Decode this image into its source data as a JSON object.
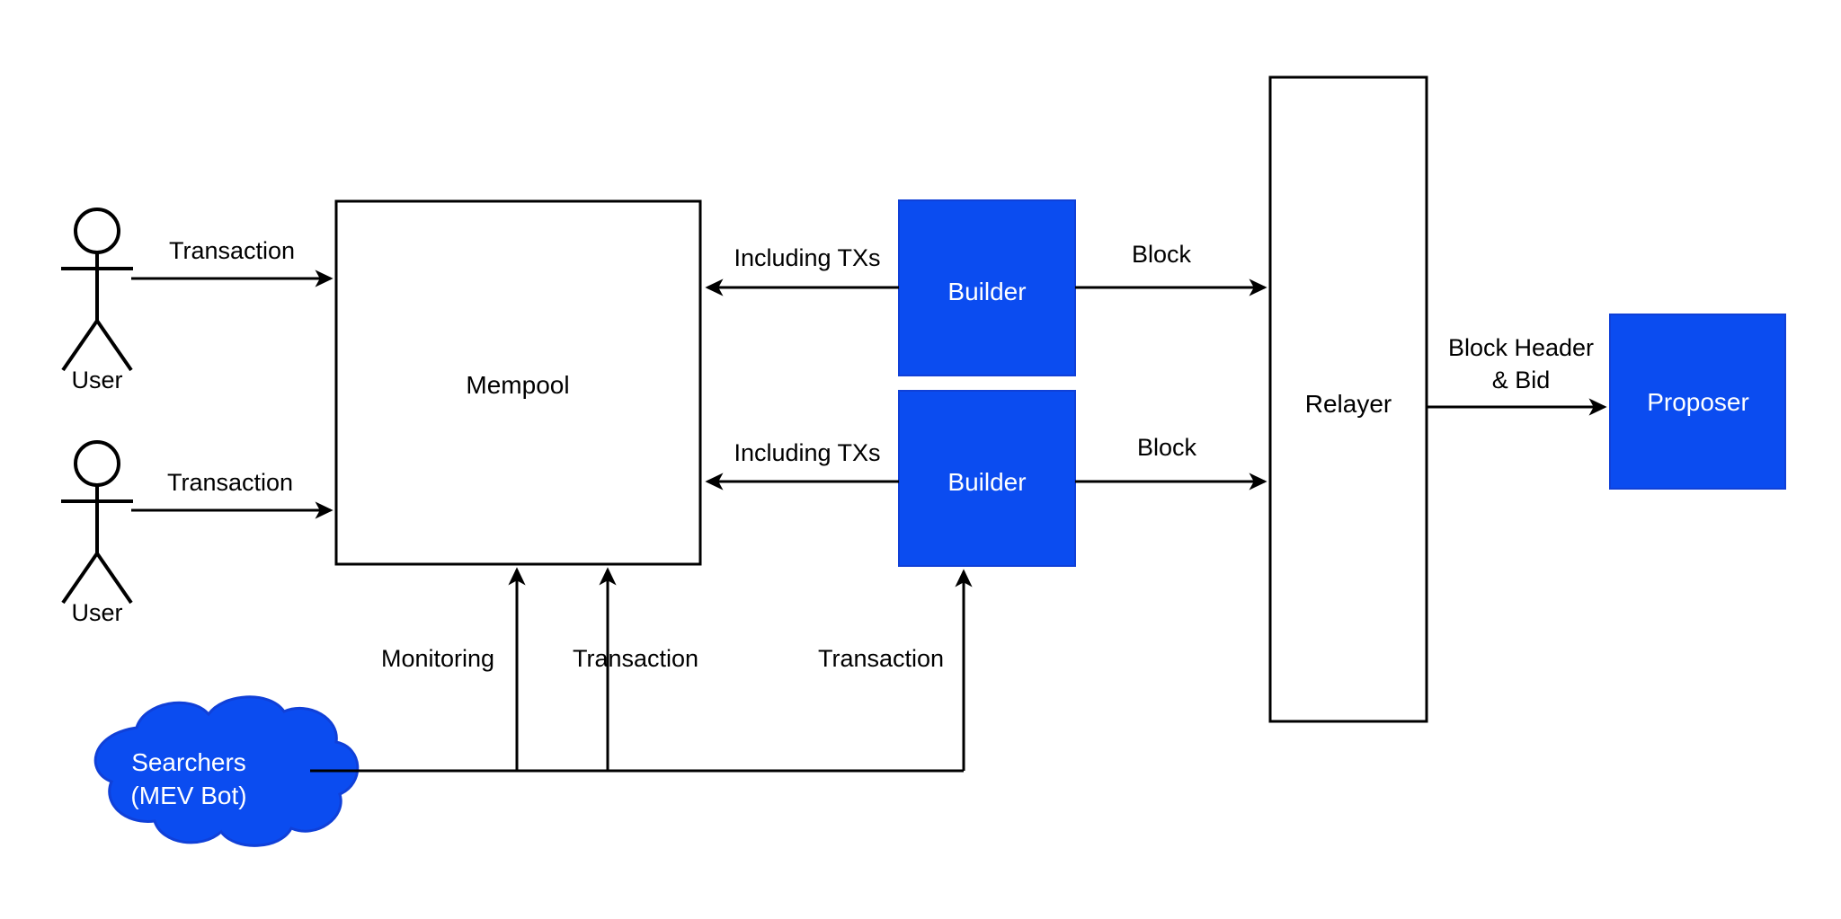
{
  "diagram": {
    "title": "MEV-Boost / Proposer-Builder Separation flow",
    "colors": {
      "blue_fill": "#0B4CF0",
      "blue_stroke": "#1040d8",
      "outline": "#000000",
      "background": "#ffffff",
      "label_text": "#000000",
      "node_text_on_blue": "#ffffff"
    },
    "nodes": {
      "user_top": {
        "label": "User",
        "type": "actor"
      },
      "user_bottom": {
        "label": "User",
        "type": "actor"
      },
      "mempool": {
        "label": "Mempool",
        "type": "box"
      },
      "builder_top": {
        "label": "Builder",
        "type": "blue-box"
      },
      "builder_bottom": {
        "label": "Builder",
        "type": "blue-box"
      },
      "relayer": {
        "label": "Relayer",
        "type": "box"
      },
      "proposer": {
        "label": "Proposer",
        "type": "blue-box"
      },
      "searchers": {
        "label_line1": "Searchers",
        "label_line2": "(MEV Bot)",
        "type": "cloud"
      }
    },
    "edges": [
      {
        "id": "user-top-to-mempool",
        "label": "Transaction"
      },
      {
        "id": "user-bottom-to-mempool",
        "label": "Transaction"
      },
      {
        "id": "builder-top-to-mempool",
        "label": "Including TXs"
      },
      {
        "id": "builder-bottom-to-mempool",
        "label": "Including TXs"
      },
      {
        "id": "builder-top-to-relayer",
        "label": "Block"
      },
      {
        "id": "builder-bottom-to-relayer",
        "label": "Block"
      },
      {
        "id": "relayer-to-proposer",
        "label_line1": "Block Header",
        "label_line2": "& Bid"
      },
      {
        "id": "searchers-monitoring-mempool",
        "label": "Monitoring"
      },
      {
        "id": "searchers-transaction-mempool",
        "label": "Transaction"
      },
      {
        "id": "searchers-transaction-builder",
        "label": "Transaction"
      }
    ]
  }
}
